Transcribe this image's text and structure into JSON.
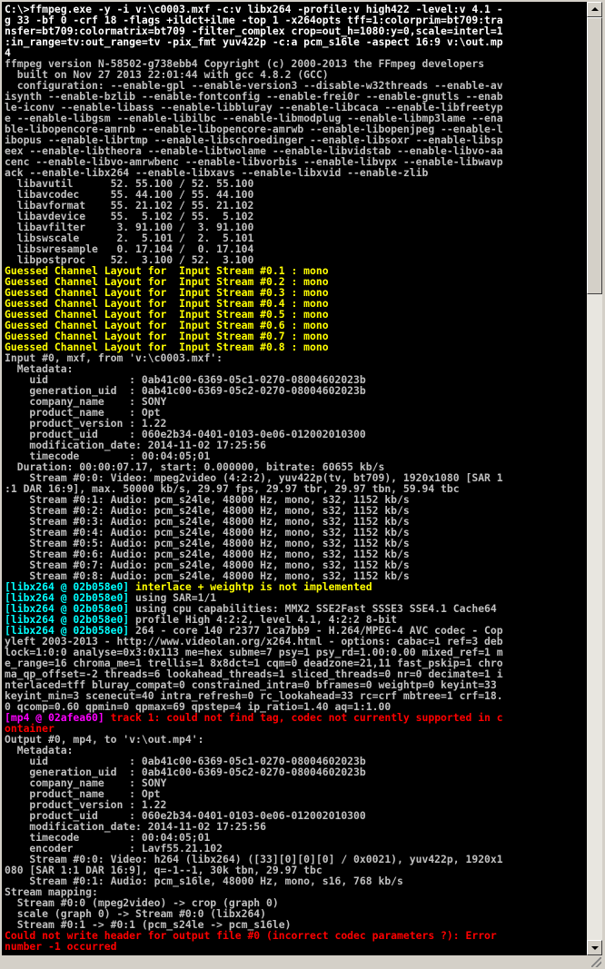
{
  "console": {
    "lines": [
      {
        "text": "C:\\>ffmpeg.exe -y -i v:\\c0003.mxf -c:v libx264 -profile:v high422 -level:v 4.1 -",
        "color": "white"
      },
      {
        "text": "g 33 -bf 0 -crf 18 -flags +ildct+ilme -top 1 -x264opts tff=1:colorprim=bt709:tra",
        "color": "white"
      },
      {
        "text": "nsfer=bt709:colormatrix=bt709 -filter_complex crop=out_h=1080:y=0,scale=interl=1",
        "color": "white"
      },
      {
        "text": ":in_range=tv:out_range=tv -pix_fmt yuv422p -c:a pcm_s16le -aspect 16:9 v:\\out.mp",
        "color": "white"
      },
      {
        "text": "4",
        "color": "white"
      },
      {
        "text": "ffmpeg version N-58502-g738ebb4 Copyright (c) 2000-2013 the FFmpeg developers",
        "color": "gray"
      },
      {
        "text": "  built on Nov 27 2013 22:01:44 with gcc 4.8.2 (GCC)",
        "color": "gray"
      },
      {
        "text": "  configuration: --enable-gpl --enable-version3 --disable-w32threads --enable-av",
        "color": "gray"
      },
      {
        "text": "isynth --enable-bzlib --enable-fontconfig --enable-frei0r --enable-gnutls --enab",
        "color": "gray"
      },
      {
        "text": "le-iconv --enable-libass --enable-libbluray --enable-libcaca --enable-libfreetyp",
        "color": "gray"
      },
      {
        "text": "e --enable-libgsm --enable-libilbc --enable-libmodplug --enable-libmp3lame --ena",
        "color": "gray"
      },
      {
        "text": "ble-libopencore-amrnb --enable-libopencore-amrwb --enable-libopenjpeg --enable-l",
        "color": "gray"
      },
      {
        "text": "ibopus --enable-librtmp --enable-libschroedinger --enable-libsoxr --enable-libsp",
        "color": "gray"
      },
      {
        "text": "eex --enable-libtheora --enable-libtwolame --enable-libvidstab --enable-libvo-aa",
        "color": "gray"
      },
      {
        "text": "cenc --enable-libvo-amrwbenc --enable-libvorbis --enable-libvpx --enable-libwavp",
        "color": "gray"
      },
      {
        "text": "ack --enable-libx264 --enable-libxavs --enable-libxvid --enable-zlib",
        "color": "gray"
      },
      {
        "text": "  libavutil      52. 55.100 / 52. 55.100",
        "color": "gray"
      },
      {
        "text": "  libavcodec     55. 44.100 / 55. 44.100",
        "color": "gray"
      },
      {
        "text": "  libavformat    55. 21.102 / 55. 21.102",
        "color": "gray"
      },
      {
        "text": "  libavdevice    55.  5.102 / 55.  5.102",
        "color": "gray"
      },
      {
        "text": "  libavfilter     3. 91.100 /  3. 91.100",
        "color": "gray"
      },
      {
        "text": "  libswscale      2.  5.101 /  2.  5.101",
        "color": "gray"
      },
      {
        "text": "  libswresample   0. 17.104 /  0. 17.104",
        "color": "gray"
      },
      {
        "text": "  libpostproc    52.  3.100 / 52.  3.100",
        "color": "gray"
      },
      {
        "text": "Guessed Channel Layout for  Input Stream #0.1 : mono",
        "color": "yellow"
      },
      {
        "text": "Guessed Channel Layout for  Input Stream #0.2 : mono",
        "color": "yellow"
      },
      {
        "text": "Guessed Channel Layout for  Input Stream #0.3 : mono",
        "color": "yellow"
      },
      {
        "text": "Guessed Channel Layout for  Input Stream #0.4 : mono",
        "color": "yellow"
      },
      {
        "text": "Guessed Channel Layout for  Input Stream #0.5 : mono",
        "color": "yellow"
      },
      {
        "text": "Guessed Channel Layout for  Input Stream #0.6 : mono",
        "color": "yellow"
      },
      {
        "text": "Guessed Channel Layout for  Input Stream #0.7 : mono",
        "color": "yellow"
      },
      {
        "text": "Guessed Channel Layout for  Input Stream #0.8 : mono",
        "color": "yellow"
      },
      {
        "text": "Input #0, mxf, from 'v:\\c0003.mxf':",
        "color": "gray"
      },
      {
        "text": "  Metadata:",
        "color": "gray"
      },
      {
        "text": "    uid             : 0ab41c00-6369-05c1-0270-08004602023b",
        "color": "gray"
      },
      {
        "text": "    generation_uid  : 0ab41c00-6369-05c2-0270-08004602023b",
        "color": "gray"
      },
      {
        "text": "    company_name    : SONY",
        "color": "gray"
      },
      {
        "text": "    product_name    : Opt",
        "color": "gray"
      },
      {
        "text": "    product_version : 1.22",
        "color": "gray"
      },
      {
        "text": "    product_uid     : 060e2b34-0401-0103-0e06-012002010300",
        "color": "gray"
      },
      {
        "text": "    modification_date: 2014-11-02 17:25:56",
        "color": "gray"
      },
      {
        "text": "    timecode        : 00:04:05;01",
        "color": "gray"
      },
      {
        "text": "  Duration: 00:00:07.17, start: 0.000000, bitrate: 60655 kb/s",
        "color": "gray"
      },
      {
        "text": "    Stream #0:0: Video: mpeg2video (4:2:2), yuv422p(tv, bt709), 1920x1080 [SAR 1",
        "color": "gray"
      },
      {
        "text": ":1 DAR 16:9], max. 50000 kb/s, 29.97 fps, 29.97 tbr, 29.97 tbn, 59.94 tbc",
        "color": "gray"
      },
      {
        "text": "    Stream #0:1: Audio: pcm_s24le, 48000 Hz, mono, s32, 1152 kb/s",
        "color": "gray"
      },
      {
        "text": "    Stream #0:2: Audio: pcm_s24le, 48000 Hz, mono, s32, 1152 kb/s",
        "color": "gray"
      },
      {
        "text": "    Stream #0:3: Audio: pcm_s24le, 48000 Hz, mono, s32, 1152 kb/s",
        "color": "gray"
      },
      {
        "text": "    Stream #0:4: Audio: pcm_s24le, 48000 Hz, mono, s32, 1152 kb/s",
        "color": "gray"
      },
      {
        "text": "    Stream #0:5: Audio: pcm_s24le, 48000 Hz, mono, s32, 1152 kb/s",
        "color": "gray"
      },
      {
        "text": "    Stream #0:6: Audio: pcm_s24le, 48000 Hz, mono, s32, 1152 kb/s",
        "color": "gray"
      },
      {
        "text": "    Stream #0:7: Audio: pcm_s24le, 48000 Hz, mono, s32, 1152 kb/s",
        "color": "gray"
      },
      {
        "text": "    Stream #0:8: Audio: pcm_s24le, 48000 Hz, mono, s32, 1152 kb/s",
        "color": "gray"
      },
      {
        "text": "[libx264 @ 02b058e0] interlace + weightp is not implemented",
        "color": "cyan",
        "tail": " interlace + weightp is not implemented",
        "tail_color": "yellow"
      },
      {
        "text": "[libx264 @ 02b058e0] using SAR=1/1",
        "color": "cyan",
        "tail": " using SAR=1/1",
        "tail_color": "gray"
      },
      {
        "text": "[libx264 @ 02b058e0] using cpu capabilities: MMX2 SSE2Fast SSSE3 SSE4.1 Cache64",
        "color": "cyan",
        "tail": " using cpu capabilities: MMX2 SSE2Fast SSSE3 SSE4.1 Cache64",
        "tail_color": "gray"
      },
      {
        "text": "[libx264 @ 02b058e0] profile High 4:2:2, level 4.1, 4:2:2 8-bit",
        "color": "cyan",
        "tail": " profile High 4:2:2, level 4.1, 4:2:2 8-bit",
        "tail_color": "gray"
      },
      {
        "text": "[libx264 @ 02b058e0] 264 - core 140 r2377 1ca7bb9 - H.264/MPEG-4 AVC codec - Cop",
        "color": "cyan",
        "tail": " 264 - core 140 r2377 1ca7bb9 - H.264/MPEG-4 AVC codec - Cop",
        "tail_color": "gray"
      },
      {
        "text": "yleft 2003-2013 - http://www.videolan.org/x264.html - options: cabac=1 ref=3 deb",
        "color": "gray"
      },
      {
        "text": "lock=1:0:0 analyse=0x3:0x113 me=hex subme=7 psy=1 psy_rd=1.00:0.00 mixed_ref=1 m",
        "color": "gray"
      },
      {
        "text": "e_range=16 chroma_me=1 trellis=1 8x8dct=1 cqm=0 deadzone=21,11 fast_pskip=1 chro",
        "color": "gray"
      },
      {
        "text": "ma_qp_offset=-2 threads=6 lookahead_threads=1 sliced_threads=0 nr=0 decimate=1 i",
        "color": "gray"
      },
      {
        "text": "nterlaced=tff bluray_compat=0 constrained_intra=0 bframes=0 weightp=0 keyint=33",
        "color": "gray"
      },
      {
        "text": "keyint_min=3 scenecut=40 intra_refresh=0 rc_lookahead=33 rc=crf mbtree=1 crf=18.",
        "color": "gray"
      },
      {
        "text": "0 qcomp=0.60 qpmin=0 qpmax=69 qpstep=4 ip_ratio=1.40 aq=1:1.00",
        "color": "gray"
      },
      {
        "text": "[mp4 @ 02afea60] track 1: could not find tag, codec not currently supported in c",
        "color": "magenta",
        "tail": " track 1: could not find tag, codec not currently supported in c",
        "tail_color": "red"
      },
      {
        "text": "ontainer",
        "color": "red"
      },
      {
        "text": "Output #0, mp4, to 'v:\\out.mp4':",
        "color": "gray"
      },
      {
        "text": "  Metadata:",
        "color": "gray"
      },
      {
        "text": "    uid             : 0ab41c00-6369-05c1-0270-08004602023b",
        "color": "gray"
      },
      {
        "text": "    generation_uid  : 0ab41c00-6369-05c2-0270-08004602023b",
        "color": "gray"
      },
      {
        "text": "    company_name    : SONY",
        "color": "gray"
      },
      {
        "text": "    product_name    : Opt",
        "color": "gray"
      },
      {
        "text": "    product_version : 1.22",
        "color": "gray"
      },
      {
        "text": "    product_uid     : 060e2b34-0401-0103-0e06-012002010300",
        "color": "gray"
      },
      {
        "text": "    modification_date: 2014-11-02 17:25:56",
        "color": "gray"
      },
      {
        "text": "    timecode        : 00:04:05;01",
        "color": "gray"
      },
      {
        "text": "    encoder         : Lavf55.21.102",
        "color": "gray"
      },
      {
        "text": "    Stream #0:0: Video: h264 (libx264) ([33][0][0][0] / 0x0021), yuv422p, 1920x1",
        "color": "gray"
      },
      {
        "text": "080 [SAR 1:1 DAR 16:9], q=-1--1, 30k tbn, 29.97 tbc",
        "color": "gray"
      },
      {
        "text": "    Stream #0:1: Audio: pcm_s16le, 48000 Hz, mono, s16, 768 kb/s",
        "color": "gray"
      },
      {
        "text": "Stream mapping:",
        "color": "gray"
      },
      {
        "text": "  Stream #0:0 (mpeg2video) -> crop (graph 0)",
        "color": "gray"
      },
      {
        "text": "  scale (graph 0) -> Stream #0:0 (libx264)",
        "color": "gray"
      },
      {
        "text": "  Stream #0:1 -> #0:1 (pcm_s24le -> pcm_s16le)",
        "color": "gray"
      },
      {
        "text": "Could not write header for output file #0 (incorrect codec parameters ?): Error",
        "color": "red"
      },
      {
        "text": "number -1 occurred",
        "color": "red"
      }
    ]
  },
  "colors": {
    "background": "#000000",
    "gray": "#c0c0c0",
    "yellow": "#ffff00",
    "cyan": "#00ffff",
    "magenta": "#ff00ff",
    "red": "#ff0000",
    "white": "#ffffff"
  },
  "scrollbar": {
    "up_icon": "arrow-up-icon",
    "down_icon": "arrow-down-icon"
  }
}
